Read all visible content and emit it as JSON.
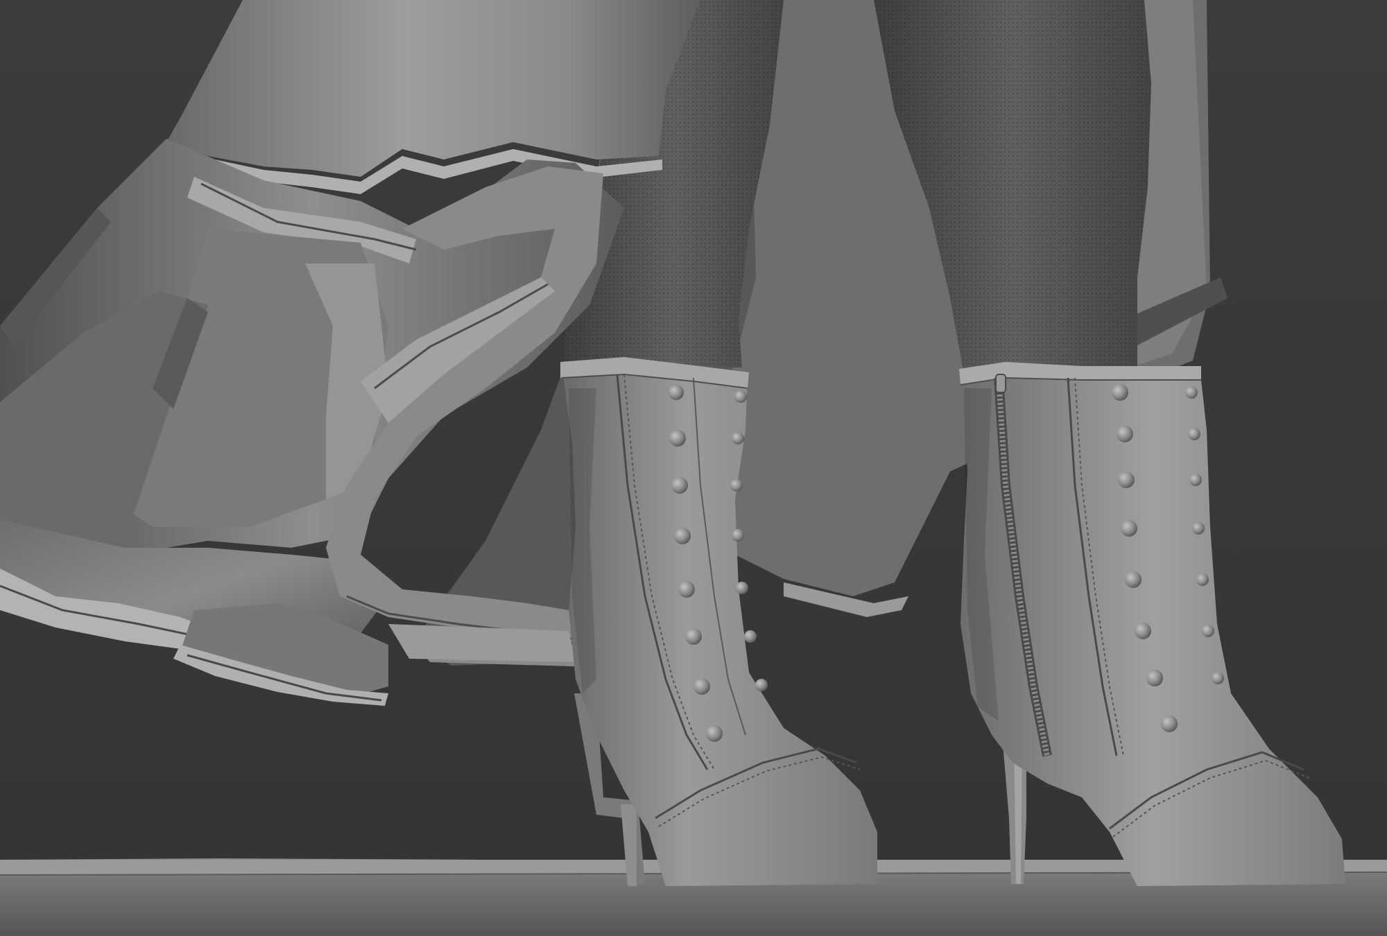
{
  "scene": {
    "subject": "sculpt-render",
    "colors": {
      "background": "#3a3a3a",
      "clay_light": "#a9a9a9",
      "clay_mid": "#7e7e7e",
      "clay_dark": "#4a4a4a",
      "shadow": "#2c2c2c",
      "stocking": "#5a5a5a"
    },
    "boots": {
      "left_button_count": 8,
      "right_button_count": 8,
      "right_has_zipper": true
    }
  }
}
